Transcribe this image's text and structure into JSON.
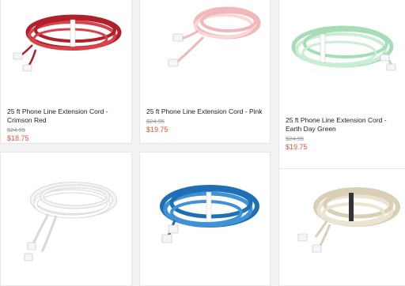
{
  "products": [
    {
      "title": "25 ft Phone Line Extension Cord - Crimson Red",
      "original_price": "$24.95",
      "sale_price": "$18.75",
      "cord_color": "#b0202a",
      "cord_highlight": "#d9414b"
    },
    {
      "title": "25 ft Phone Line Extension Cord - Pink",
      "original_price": "$24.95",
      "sale_price": "$19.75",
      "cord_color": "#f0b8b8",
      "cord_highlight": "#fad6d6"
    },
    {
      "title": "25 ft Phone Line Extension Cord - Earth Day Green",
      "original_price": "$24.95",
      "sale_price": "$19.75",
      "cord_color": "#a6dcb6",
      "cord_highlight": "#c9eed4"
    },
    {
      "title": "",
      "original_price": "",
      "sale_price": "",
      "cord_color": "#f4f4f4",
      "cord_highlight": "#ffffff"
    },
    {
      "title": "",
      "original_price": "",
      "sale_price": "",
      "cord_color": "#1f6fb4",
      "cord_highlight": "#3f92d6"
    },
    {
      "title": "",
      "original_price": "",
      "sale_price": "",
      "cord_color": "#d8cfb6",
      "cord_highlight": "#ebe4d2"
    }
  ],
  "colors": {
    "sale_price": "#e8513c",
    "old_price": "#999999",
    "title": "#222222"
  }
}
